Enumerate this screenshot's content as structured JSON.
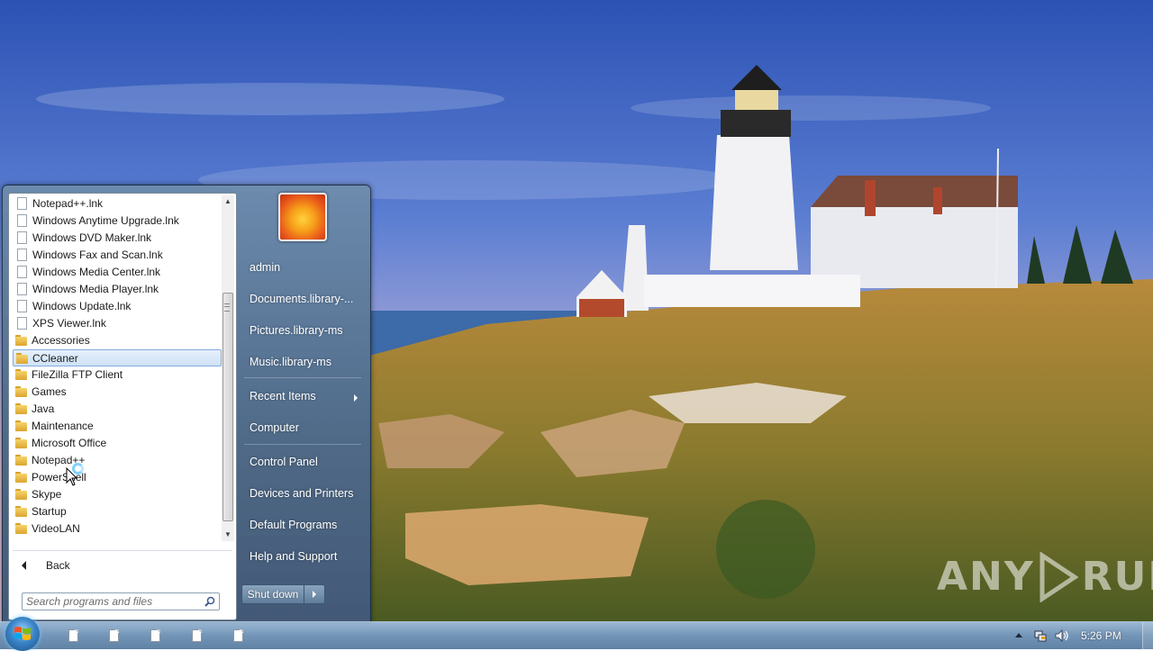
{
  "watermark": {
    "part1": "ANY",
    "part2": "RUN"
  },
  "programs": [
    {
      "label": "Notepad++.lnk",
      "icon": "document-icon"
    },
    {
      "label": "Windows Anytime Upgrade.lnk",
      "icon": "document-icon"
    },
    {
      "label": "Windows DVD Maker.lnk",
      "icon": "document-icon"
    },
    {
      "label": "Windows Fax and Scan.lnk",
      "icon": "document-icon"
    },
    {
      "label": "Windows Media Center.lnk",
      "icon": "document-icon"
    },
    {
      "label": "Windows Media Player.lnk",
      "icon": "document-icon"
    },
    {
      "label": "Windows Update.lnk",
      "icon": "document-icon"
    },
    {
      "label": "XPS Viewer.lnk",
      "icon": "document-icon"
    },
    {
      "label": "Accessories",
      "icon": "folder-icon"
    },
    {
      "label": "CCleaner",
      "icon": "folder-icon",
      "selected": true
    },
    {
      "label": "FileZilla FTP Client",
      "icon": "folder-icon"
    },
    {
      "label": "Games",
      "icon": "folder-icon"
    },
    {
      "label": "Java",
      "icon": "folder-icon"
    },
    {
      "label": "Maintenance",
      "icon": "folder-icon"
    },
    {
      "label": "Microsoft Office",
      "icon": "folder-icon"
    },
    {
      "label": "Notepad++",
      "icon": "folder-icon"
    },
    {
      "label": "PowerShell",
      "icon": "folder-icon"
    },
    {
      "label": "Skype",
      "icon": "folder-icon"
    },
    {
      "label": "Startup",
      "icon": "folder-icon"
    },
    {
      "label": "VideoLAN",
      "icon": "folder-icon"
    }
  ],
  "back_label": "Back",
  "search": {
    "placeholder": "Search programs and files"
  },
  "right_pane": {
    "user": "admin",
    "documents": "Documents.library-...",
    "pictures": "Pictures.library-ms",
    "music": "Music.library-ms",
    "recent": "Recent Items",
    "computer": "Computer",
    "control_panel": "Control Panel",
    "devices": "Devices and Printers",
    "default_programs": "Default Programs",
    "help": "Help and Support"
  },
  "shutdown_label": "Shut down",
  "taskbar": {
    "clock": "5:26 PM",
    "pinned_documents": 5
  },
  "colors": {
    "selection": "#cfe2f6",
    "taskbar": "#6e91b4",
    "menu": "#46647f"
  }
}
